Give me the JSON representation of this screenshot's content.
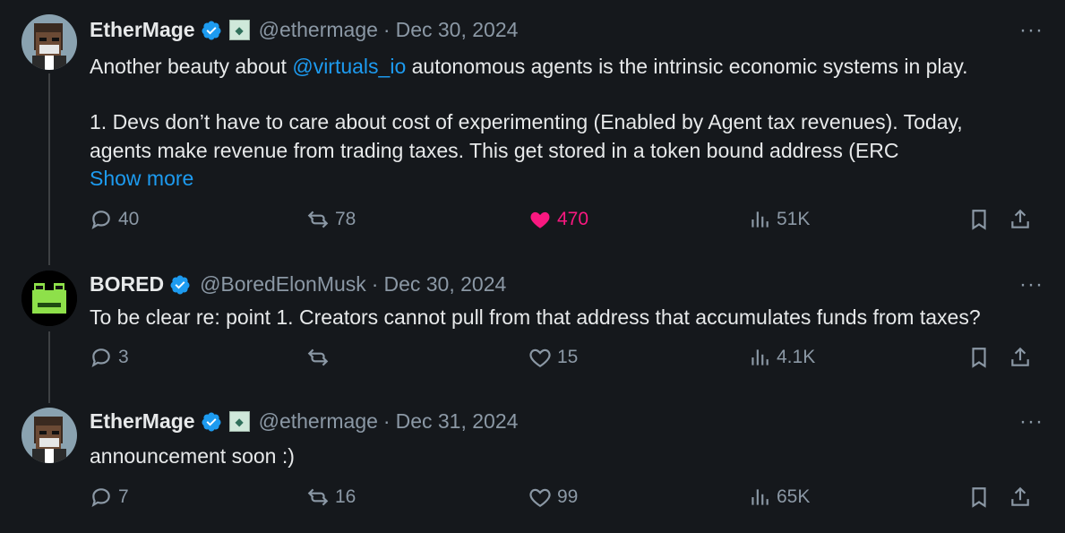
{
  "tweets": [
    {
      "name": "EtherMage",
      "handle": "@ethermage",
      "sep": "·",
      "date": "Dec 30, 2024",
      "more": "···",
      "text_before": "Another beauty about ",
      "mention": "@virtuals_io",
      "text_after": " autonomous agents is the intrinsic economic systems in play.",
      "para2_line1": "1. Devs don’t have to care about cost of experimenting (Enabled by Agent tax revenues). Today,",
      "para2_line2": "agents make revenue from trading taxes. This get stored in a token bound address (ERC",
      "show_more": "Show more",
      "replies": "40",
      "reposts": "78",
      "likes": "470",
      "views": "51K"
    },
    {
      "name": "BORED",
      "handle": "@BoredElonMusk",
      "sep": "·",
      "date": "Dec 30, 2024",
      "more": "···",
      "text": "To be clear re: point 1. Creators cannot pull from that address that accumulates funds from taxes?",
      "replies": "3",
      "reposts": "",
      "likes": "15",
      "views": "4.1K"
    },
    {
      "name": "EtherMage",
      "handle": "@ethermage",
      "sep": "·",
      "date": "Dec 31, 2024",
      "more": "···",
      "text": "announcement soon :)",
      "replies": "7",
      "reposts": "16",
      "likes": "99",
      "views": "65K"
    }
  ],
  "colors": {
    "bg": "#15181c",
    "accent": "#1d9bf0",
    "like": "#f91880",
    "muted": "#8b98a5"
  },
  "icons": [
    "reply-icon",
    "repost-icon",
    "like-icon",
    "views-icon",
    "bookmark-icon",
    "share-icon",
    "verified-badge-icon"
  ]
}
